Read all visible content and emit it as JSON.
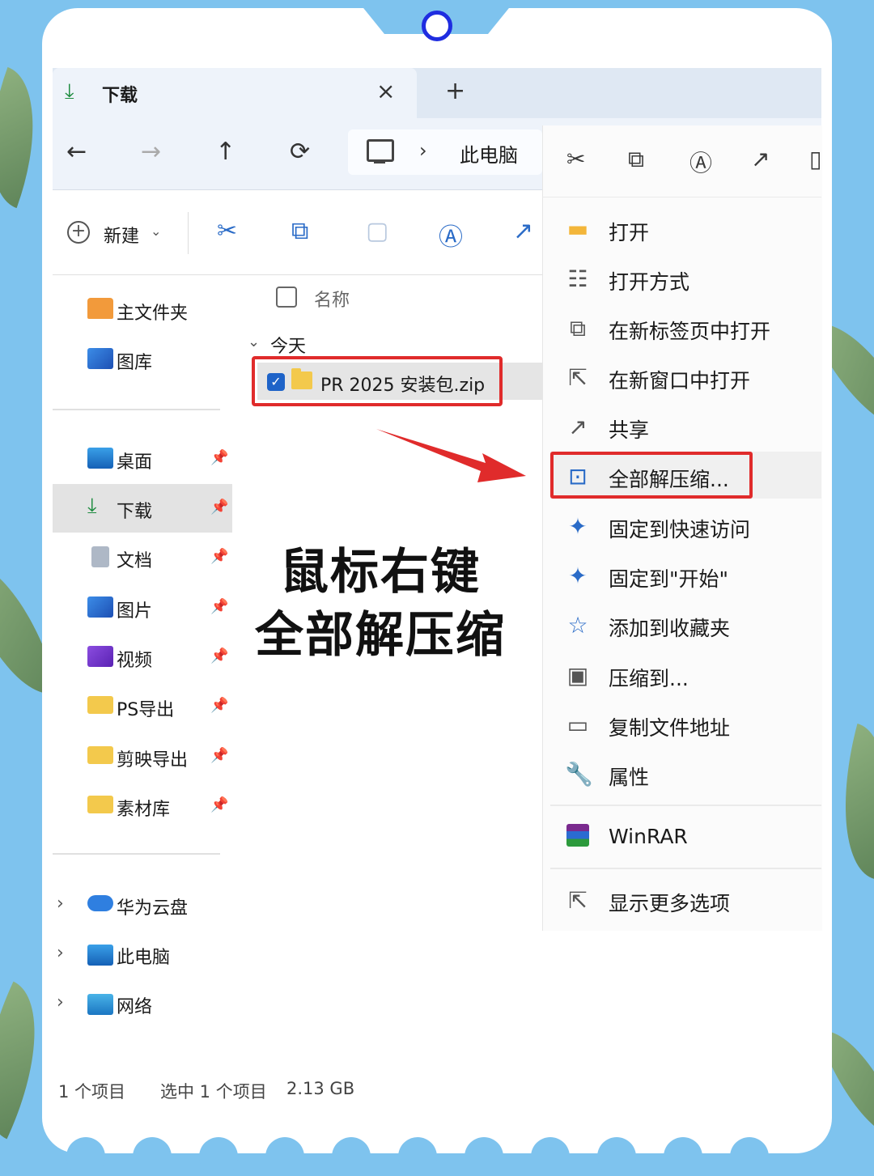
{
  "tab": {
    "title": "下载",
    "close": "×",
    "add": "+"
  },
  "nav": {
    "back": "←",
    "forward": "→",
    "up": "↑",
    "refresh": "⟳",
    "chevron": "›",
    "location": "此电脑"
  },
  "toolbar": {
    "new_label": "新建",
    "new_caret": "⌄"
  },
  "sidebar": {
    "top": [
      {
        "label": "主文件夹",
        "icon": "home-icon"
      },
      {
        "label": "图库",
        "icon": "gallery-icon"
      }
    ],
    "quick": [
      {
        "label": "桌面",
        "icon": "desktop-icon"
      },
      {
        "label": "下载",
        "icon": "download-icon"
      },
      {
        "label": "文档",
        "icon": "document-icon"
      },
      {
        "label": "图片",
        "icon": "pictures-icon"
      },
      {
        "label": "视频",
        "icon": "video-icon"
      },
      {
        "label": "PS导出",
        "icon": "folder-icon"
      },
      {
        "label": "剪映导出",
        "icon": "folder-icon"
      },
      {
        "label": "素材库",
        "icon": "folder-icon"
      }
    ],
    "locations": [
      {
        "label": "华为云盘",
        "icon": "cloud-icon"
      },
      {
        "label": "此电脑",
        "icon": "computer-icon"
      },
      {
        "label": "网络",
        "icon": "network-icon"
      }
    ]
  },
  "list": {
    "header_name": "名称",
    "group": "今天",
    "group_chev": "⌄",
    "file_name": "PR 2025 安装包.zip"
  },
  "headline": {
    "line1": "鼠标右键",
    "line2": "全部解压缩"
  },
  "context_menu": {
    "items": [
      {
        "label": "打开",
        "icon": "folder-icon"
      },
      {
        "label": "打开方式",
        "icon": "open-with-icon"
      },
      {
        "label": "在新标签页中打开",
        "icon": "new-tab-icon"
      },
      {
        "label": "在新窗口中打开",
        "icon": "new-window-icon"
      },
      {
        "label": "共享",
        "icon": "share-icon"
      },
      {
        "label": "全部解压缩...",
        "icon": "extract-icon"
      },
      {
        "label": "固定到快速访问",
        "icon": "pin-icon"
      },
      {
        "label": "固定到\"开始\"",
        "icon": "pin-icon"
      },
      {
        "label": "添加到收藏夹",
        "icon": "star-icon"
      },
      {
        "label": "压缩到...",
        "icon": "zip-icon"
      },
      {
        "label": "复制文件地址",
        "icon": "copy-path-icon"
      },
      {
        "label": "属性",
        "icon": "wrench-icon"
      }
    ],
    "winrar": "WinRAR",
    "more": "显示更多选项"
  },
  "status": {
    "count": "1 个项目",
    "selected": "选中 1 个项目",
    "size": "2.13 GB"
  },
  "colors": {
    "background": "#7ec3ee",
    "highlight": "#e02b2b",
    "accent": "#1e63c8"
  }
}
